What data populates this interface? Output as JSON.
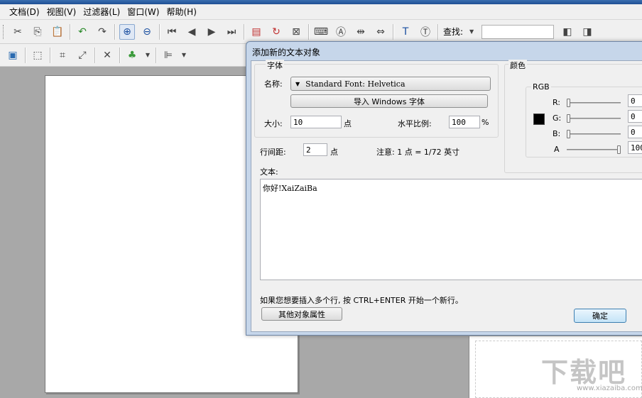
{
  "menubar": {
    "items": [
      "文档(D)",
      "视图(V)",
      "过滤器(L)",
      "窗口(W)",
      "帮助(H)"
    ]
  },
  "toolbar": {
    "find_label": "查找:",
    "find_value": ""
  },
  "dialog": {
    "title": "添加新的文本对象",
    "font_group": {
      "label": "字体",
      "name_label": "名称:",
      "font_name": "Standard Font: Helvetica",
      "import_button": "导入 Windows 字体",
      "size_label": "大小:",
      "size_value": "10",
      "size_unit": "点",
      "hscale_label": "水平比例:",
      "hscale_value": "100",
      "hscale_unit": "%"
    },
    "line_spacing_label": "行间距:",
    "line_spacing_value": "2",
    "line_spacing_unit": "点",
    "note": "注意: 1 点 = 1/72 英寸",
    "color_group": {
      "label": "颜色",
      "rgb_label": "RGB",
      "swatch_color": "#000000",
      "channels": [
        {
          "label": "R:",
          "value": "0",
          "level": 0
        },
        {
          "label": "G:",
          "value": "0",
          "level": 0
        },
        {
          "label": "B:",
          "value": "0",
          "level": 0
        },
        {
          "label": "A",
          "value": "100",
          "level": 1
        }
      ]
    },
    "text_label": "文本:",
    "text_value": "你好!XaiZaiBa",
    "hint": "如果您想要插入多个行, 按 CTRL+ENTER 开始一个新行。",
    "other_props_button": "其他对象属性",
    "ok_button": "确定"
  },
  "watermark": {
    "logo": "下载吧",
    "url": "www.xiazaiba.com"
  }
}
